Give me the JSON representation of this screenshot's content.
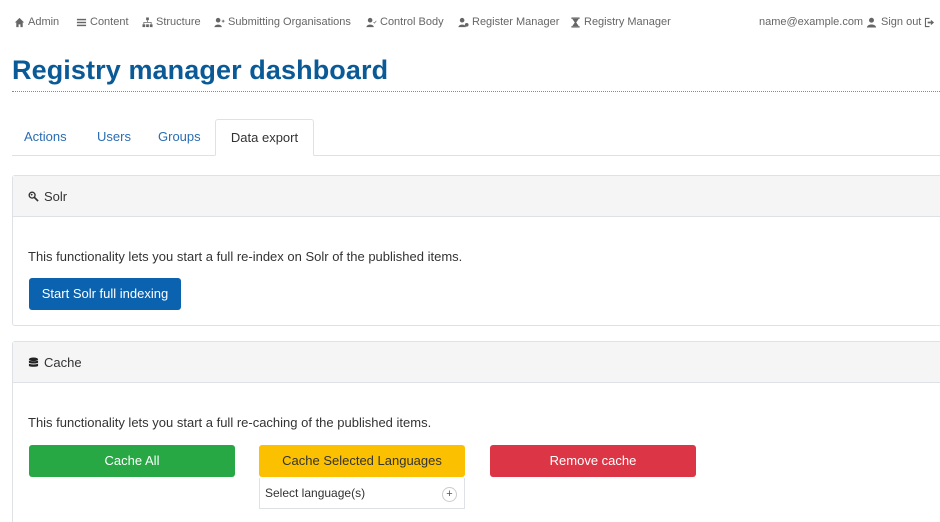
{
  "toolbar": {
    "admin": "Admin",
    "content": "Content",
    "structure": "Structure",
    "submitting": "Submitting Organisations",
    "control": "Control Body",
    "register": "Register Manager",
    "registry": "Registry Manager",
    "user": "name@example.com",
    "signout": "Sign out"
  },
  "page": {
    "title": "Registry manager dashboard"
  },
  "tabs": [
    "Actions",
    "Users",
    "Groups",
    "Data export"
  ],
  "solr": {
    "title": "Solr",
    "text": "This functionality lets you start a full re-index on Solr of the published items.",
    "button": "Start Solr full indexing"
  },
  "cache": {
    "title": "Cache",
    "text": "This functionality lets you start a full re-caching of the published items.",
    "cache_all": "Cache All",
    "cache_selected": "Cache Selected Languages",
    "remove": "Remove cache",
    "select_label": "Select language(s)",
    "plus": "+"
  },
  "colors": {
    "brand": "#0a5a97",
    "primary": "#0b62ae",
    "success": "#28a745",
    "warning": "#fbc100",
    "danger": "#dc3545"
  }
}
